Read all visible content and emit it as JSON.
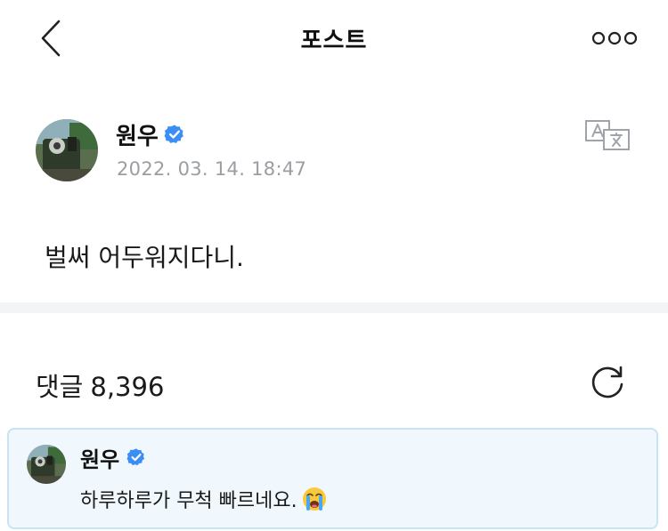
{
  "header": {
    "title": "포스트",
    "back_icon": "chevron-left-icon",
    "more_icon": "more-dots-icon"
  },
  "post": {
    "author": "원우",
    "verified_icon": "verified-badge-icon",
    "timestamp": "2022. 03. 14. 18:47",
    "translate_icon": "translate-icon",
    "body": "벌써 어두워지다니."
  },
  "comments": {
    "label": "댓글",
    "count": "8,396",
    "refresh_icon": "refresh-icon",
    "items": [
      {
        "author": "원우",
        "text": "하루하루가 무척 빠르네요.",
        "emoji_icon": "loudly-crying-face-icon"
      }
    ]
  },
  "colors": {
    "accent_blue": "#3a8ef6",
    "timestamp_gray": "#9a9ea3",
    "divider": "#f3f4f6",
    "comment_bg": "#f0f8fd",
    "comment_border": "#c8e3f3"
  }
}
